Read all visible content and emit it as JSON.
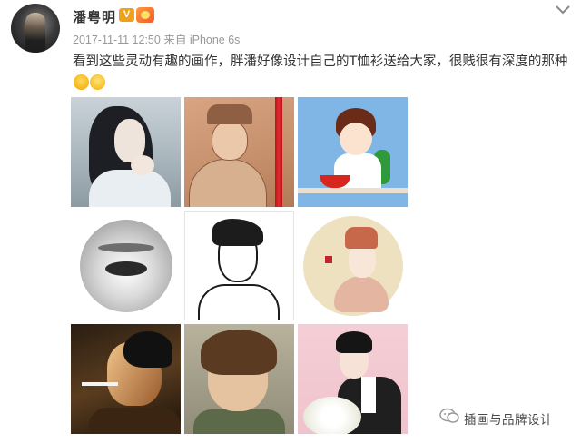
{
  "post": {
    "username": "潘粤明",
    "verified_badge": "V",
    "timestamp": "2017-11-11 12:50",
    "source_prefix": "来自",
    "source_device": "iPhone 6s",
    "text": "看到这些灵动有趣的画作，胖潘好像设计自己的T恤衫送给大家，很贱很有深度的那种",
    "emoji_icons": [
      "smirk-emoji-icon",
      "glasses-emoji-icon"
    ],
    "more_icon": "chevron-down-icon"
  },
  "photos": [
    {
      "subject": "long-haired figure"
    },
    {
      "subject": "ancient-style portrait with red pencil"
    },
    {
      "subject": "cartoon boy eating"
    },
    {
      "subject": "pencil eye drawing"
    },
    {
      "subject": "line-art portrait"
    },
    {
      "subject": "opera character painting"
    },
    {
      "subject": "man smoking painting"
    },
    {
      "subject": "short-haired portrait painting"
    },
    {
      "subject": "man with flowers painting"
    }
  ],
  "watermark": {
    "icon": "wechat-icon",
    "text": "插画与品牌设计"
  },
  "colors": {
    "username": "#333333",
    "meta": "#999999",
    "verified": "#f0a11b"
  }
}
